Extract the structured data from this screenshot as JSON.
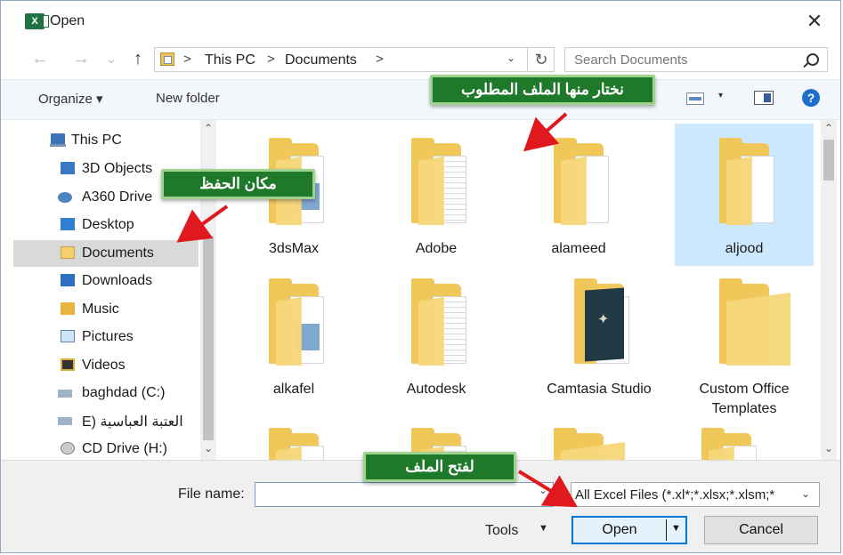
{
  "window": {
    "title": "Open",
    "app_icon_text": "X",
    "close_glyph": "✕"
  },
  "nav": {
    "back": "←",
    "forward": "→",
    "recent": "⌄",
    "up": "↑"
  },
  "address": {
    "crumbs": [
      "This PC",
      "Documents"
    ],
    "separator": ">",
    "dropdown": "⌄",
    "refresh": "↻"
  },
  "search": {
    "placeholder": "Search Documents"
  },
  "toolbar": {
    "organize": "Organize ▾",
    "new_folder": "New folder",
    "view_caret": "▾",
    "help": "?"
  },
  "sidebar": {
    "items": [
      {
        "label": "This PC",
        "icon": "computer-icon"
      },
      {
        "label": "3D Objects",
        "icon": "3d-objects-icon"
      },
      {
        "label": "A360 Drive",
        "icon": "a360-drive-icon"
      },
      {
        "label": "Desktop",
        "icon": "desktop-icon"
      },
      {
        "label": "Documents",
        "icon": "documents-icon",
        "selected": true
      },
      {
        "label": "Downloads",
        "icon": "downloads-icon"
      },
      {
        "label": "Music",
        "icon": "music-icon"
      },
      {
        "label": "Pictures",
        "icon": "pictures-icon"
      },
      {
        "label": "Videos",
        "icon": "videos-icon"
      },
      {
        "label": "baghdad (C:)",
        "icon": "drive-icon"
      },
      {
        "label": "العتبة العباسية (E",
        "icon": "drive-icon"
      },
      {
        "label": "CD Drive (H:)",
        "icon": "cd-drive-icon"
      }
    ]
  },
  "folders": [
    {
      "name": "3dsMax",
      "paper": "blue"
    },
    {
      "name": "Adobe",
      "paper": "lined"
    },
    {
      "name": "alameed",
      "paper": "plain"
    },
    {
      "name": "aljood",
      "paper": "plain",
      "selected": true
    },
    {
      "name": "alkafel",
      "paper": "blue"
    },
    {
      "name": "Autodesk",
      "paper": "lined"
    },
    {
      "name": "Camtasia Studio",
      "paper": "cover"
    },
    {
      "name": "Custom Office Templates",
      "paper": "none"
    }
  ],
  "annotations": {
    "choose_file": "نختار منها الملف المطلوب",
    "save_location": "مكان الحفظ",
    "open_file": "لفتح الملف",
    "arrow_color": "#e0191f",
    "callout_color": "#1e7a2a"
  },
  "bottom": {
    "file_name_label": "File name:",
    "file_name_value": "",
    "filter": "All Excel Files (*.xl*;*.xlsx;*.xlsm;*",
    "tools": "Tools",
    "open": "Open",
    "cancel": "Cancel"
  }
}
